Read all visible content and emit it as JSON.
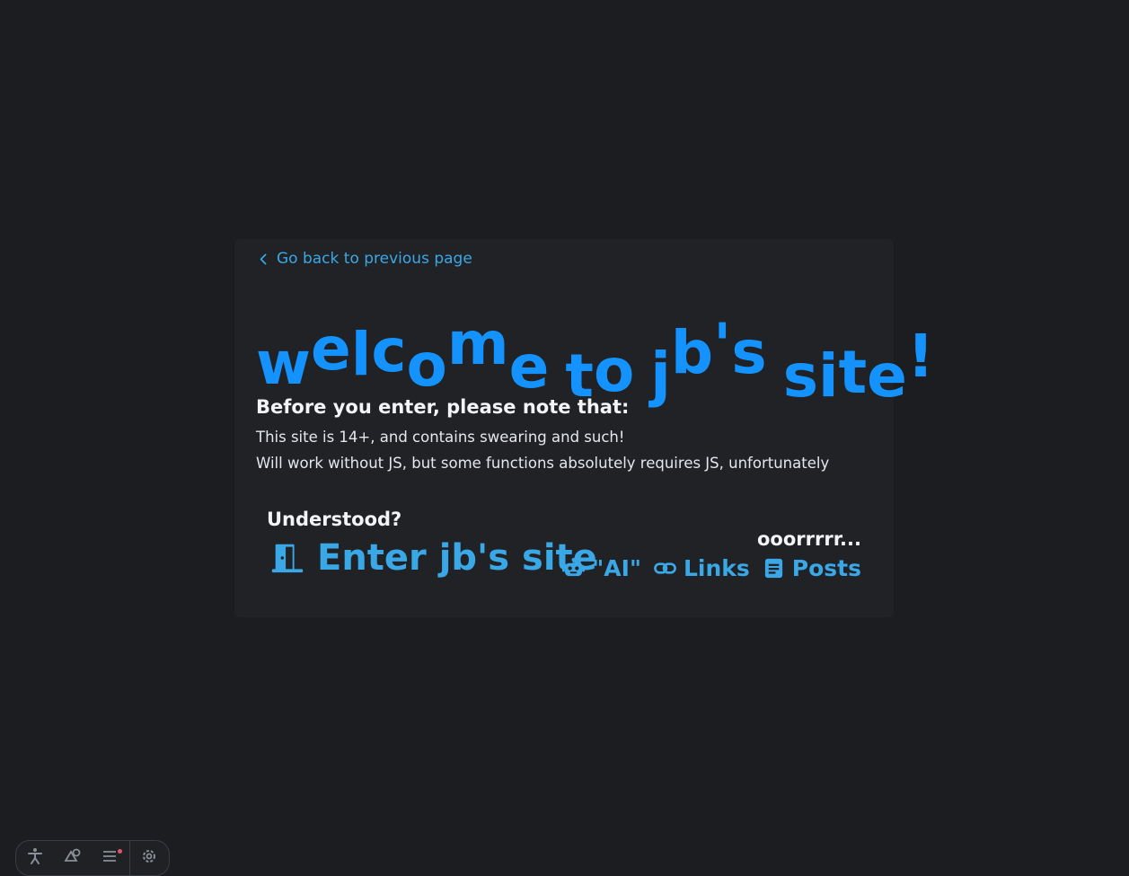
{
  "back_link": {
    "label": "Go back to previous page",
    "icon": "chevron-left-icon"
  },
  "title": {
    "words": [
      [
        "w",
        "e",
        "l",
        "c",
        "o",
        "m",
        "e"
      ],
      [
        "t",
        "o"
      ],
      [
        "j",
        "b",
        "'",
        "s"
      ],
      [
        "s",
        "i",
        "t",
        "e",
        "!"
      ]
    ],
    "color": "#1493ff"
  },
  "notice": {
    "heading": "Before you enter, please note that:",
    "line1": "This site is 14+, and contains swearing and such!",
    "line2": "Will work without JS, but some functions absolutely requires JS, unfortunately"
  },
  "enter": {
    "prompt": "Understood?",
    "label": "Enter jb's site",
    "icon": "door-icon"
  },
  "alternatives": {
    "prompt": "ooorrrrr...",
    "links": [
      {
        "label": "\"AI\"",
        "icon": "robot-icon"
      },
      {
        "label": "Links",
        "icon": "link-icon"
      },
      {
        "label": "Posts",
        "icon": "document-icon"
      }
    ]
  },
  "toolbar": {
    "buttons": [
      "accessibility-icon",
      "shapes-icon",
      "menu-icon",
      "settings-icon"
    ]
  },
  "colors": {
    "background": "#1b1d21",
    "card": "#202226",
    "accent": "#3aa8e6",
    "title": "#1493ff"
  }
}
